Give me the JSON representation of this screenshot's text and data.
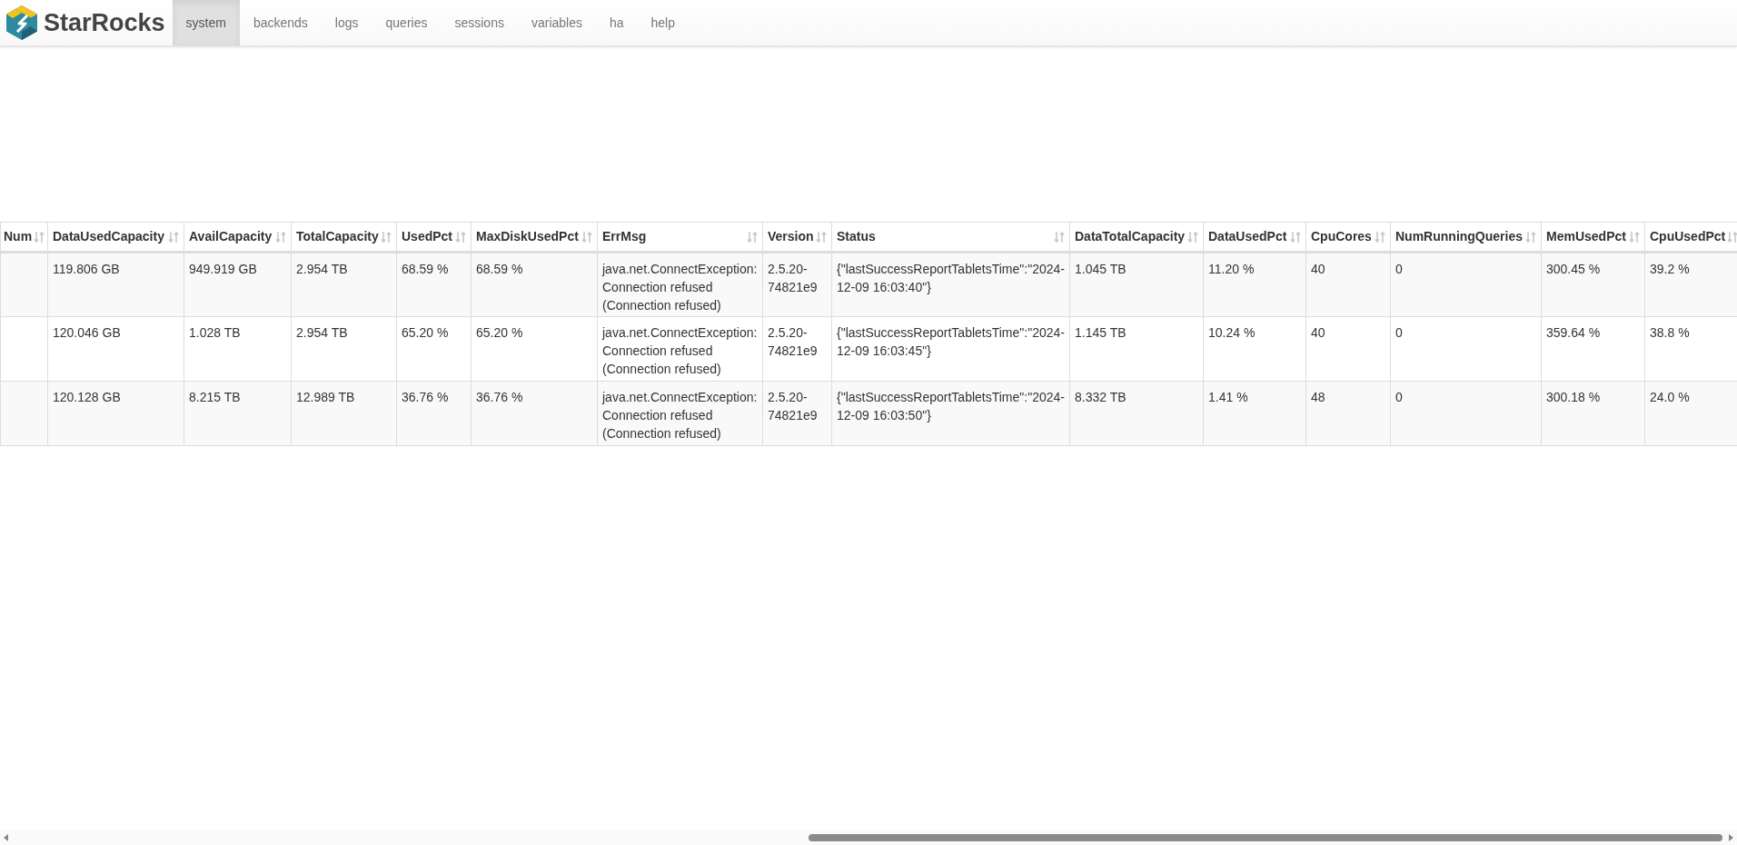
{
  "brand": "StarRocks",
  "nav": [
    {
      "label": "system",
      "selected": true
    },
    {
      "label": "backends",
      "selected": false
    },
    {
      "label": "logs",
      "selected": false
    },
    {
      "label": "queries",
      "selected": false
    },
    {
      "label": "sessions",
      "selected": false
    },
    {
      "label": "variables",
      "selected": false
    },
    {
      "label": "ha",
      "selected": false
    },
    {
      "label": "help",
      "selected": false
    }
  ],
  "table": {
    "columns": [
      "Num",
      "DataUsedCapacity",
      "AvailCapacity",
      "TotalCapacity",
      "UsedPct",
      "MaxDiskUsedPct",
      "ErrMsg",
      "Version",
      "Status",
      "DataTotalCapacity",
      "DataUsedPct",
      "CpuCores",
      "NumRunningQueries",
      "MemUsedPct",
      "CpuUsedPct"
    ],
    "rows": [
      [
        "",
        "119.806 GB",
        "949.919 GB",
        "2.954 TB",
        "68.59 %",
        "68.59 %",
        "java.net.ConnectException: Connection refused (Connection refused)",
        "2.5.20-74821e9",
        "{\"lastSuccessReportTabletsTime\":\"2024-12-09 16:03:40\"}",
        "1.045 TB",
        "11.20 %",
        "40",
        "0",
        "300.45 %",
        "39.2 %"
      ],
      [
        "",
        "120.046 GB",
        "1.028 TB",
        "2.954 TB",
        "65.20 %",
        "65.20 %",
        "java.net.ConnectException: Connection refused (Connection refused)",
        "2.5.20-74821e9",
        "{\"lastSuccessReportTabletsTime\":\"2024-12-09 16:03:45\"}",
        "1.145 TB",
        "10.24 %",
        "40",
        "0",
        "359.64 %",
        "38.8 %"
      ],
      [
        "",
        "120.128 GB",
        "8.215 TB",
        "12.989 TB",
        "36.76 %",
        "36.76 %",
        "java.net.ConnectException: Connection refused (Connection refused)",
        "2.5.20-74821e9",
        "{\"lastSuccessReportTabletsTime\":\"2024-12-09 16:03:50\"}",
        "8.332 TB",
        "1.41 %",
        "48",
        "0",
        "300.18 %",
        "24.0 %"
      ]
    ]
  }
}
